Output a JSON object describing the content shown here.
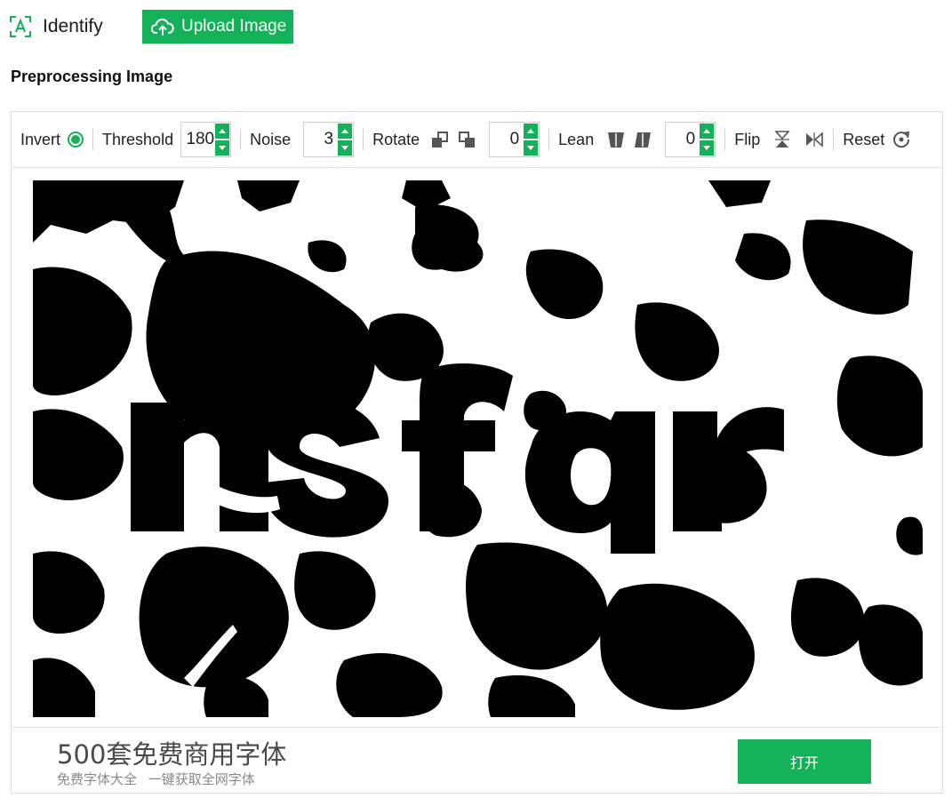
{
  "header": {
    "identify_label": "Identify",
    "identify_icon": "text-scan-icon",
    "upload_label": "Upload Image",
    "upload_icon": "cloud-upload-icon"
  },
  "section_title": "Preprocessing Image",
  "toolbar": {
    "invert_label": "Invert",
    "invert_checked": true,
    "threshold_label": "Threshold",
    "threshold_value": "180",
    "noise_label": "Noise",
    "noise_value": "3",
    "rotate_label": "Rotate",
    "rotate_value": "0",
    "rotate_icons": [
      "rotate-left-icon",
      "rotate-right-icon"
    ],
    "lean_label": "Lean",
    "lean_value": "0",
    "lean_icons": [
      "lean-left-icon",
      "lean-right-icon"
    ],
    "flip_label": "Flip",
    "flip_icons": [
      "flip-vertical-icon",
      "flip-horizontal-icon"
    ],
    "reset_label": "Reset",
    "reset_icon": "reset-icon"
  },
  "preview": {
    "captcha_text": "nsfqr"
  },
  "ad": {
    "title": "500套免费商用字体",
    "subtitle": "免费字体大全 一键获取全网字体",
    "button_label": "打开"
  },
  "colors": {
    "accent": "#13b158",
    "border": "#dcdcdc",
    "text": "#222222"
  }
}
